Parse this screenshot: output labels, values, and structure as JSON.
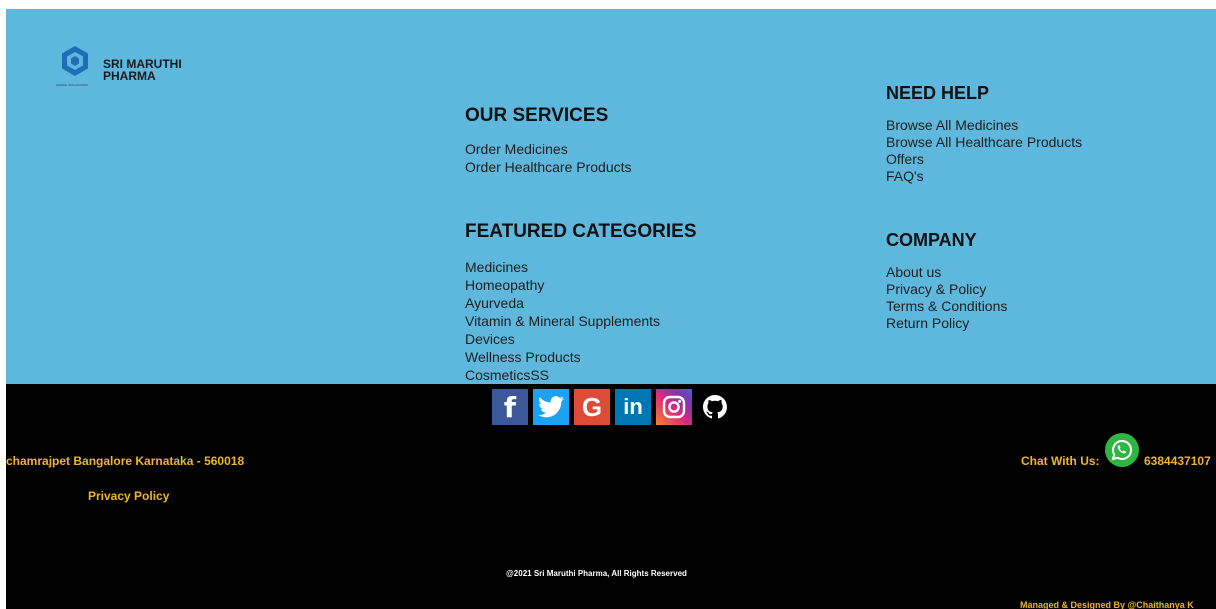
{
  "brand": {
    "name": "SRI MARUTHI PHARMA",
    "tagline": "SHRIEE ORGANISERS"
  },
  "services": {
    "heading": "OUR SERVICES",
    "items": [
      "Order Medicines",
      "Order Healthcare Products"
    ]
  },
  "categories": {
    "heading": "FEATURED CATEGORIES",
    "items": [
      "Medicines",
      "Homeopathy",
      "Ayurveda",
      "Vitamin & Mineral Supplements",
      "Devices",
      "Wellness Products",
      "CosmeticsSS"
    ]
  },
  "help": {
    "heading": "NEED HELP",
    "items": [
      "Browse All Medicines",
      "Browse All Healthcare Products",
      "Offers",
      "FAQ's"
    ]
  },
  "company": {
    "heading": "COMPANY",
    "items": [
      "About us",
      "Privacy & Policy",
      "Terms & Conditions",
      "Return Policy"
    ]
  },
  "social": [
    {
      "name": "facebook-icon",
      "glyph": "f",
      "color": "#3b5998"
    },
    {
      "name": "twitter-icon",
      "glyph": "",
      "color": "#1da1f2"
    },
    {
      "name": "google-icon",
      "glyph": "G",
      "color": "#dd4b39"
    },
    {
      "name": "linkedin-icon",
      "glyph": "in",
      "color": "#0077b5"
    },
    {
      "name": "instagram-icon",
      "glyph": "",
      "color": "#c13584"
    },
    {
      "name": "github-icon",
      "glyph": "",
      "color": "#000000"
    }
  ],
  "footer": {
    "address": "chamrajpet Bangalore Karnataka - 560018",
    "privacy_link": "Privacy Policy",
    "chat_label": "Chat With Us:",
    "phone": "6384437107",
    "copyright": "@2021 Sri Maruthi Pharma, All Rights Reserved",
    "managed": "Managed & Designed By @Chaithanya K"
  },
  "colors": {
    "top_background": "#5eb7dd",
    "bottom_background": "#000000",
    "accent_text": "#f0b429",
    "whatsapp": "#2fb542"
  }
}
